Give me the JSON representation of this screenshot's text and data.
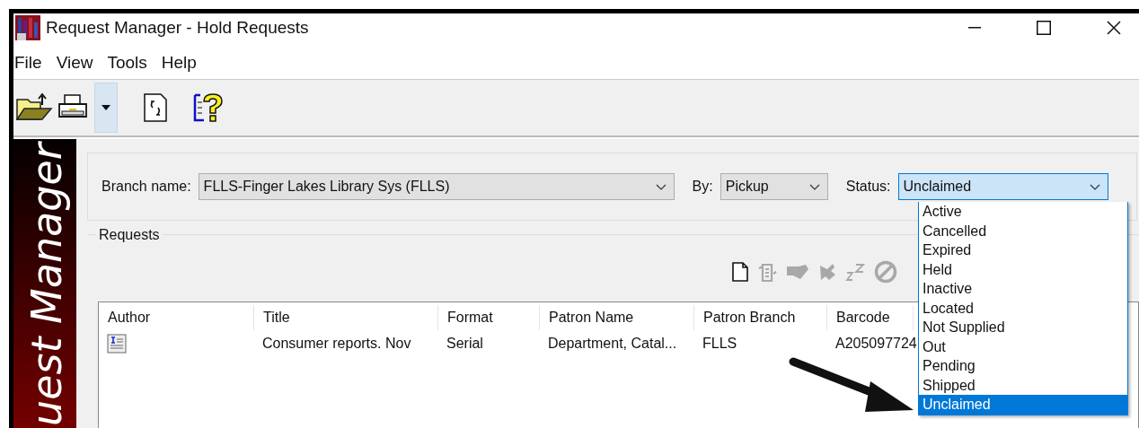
{
  "window": {
    "title": "Request Manager - Hold Requests"
  },
  "menu": [
    "File",
    "View",
    "Tools",
    "Help"
  ],
  "banner": {
    "text": "uest Manager"
  },
  "filters": [
    {
      "label": "Branch name:",
      "value": "FLLS-Finger Lakes Library Sys (FLLS)",
      "focused": false
    },
    {
      "label": "By:",
      "value": "Pickup",
      "focused": false
    },
    {
      "label": "Status:",
      "value": "Unclaimed",
      "focused": true
    }
  ],
  "status_options": [
    {
      "label": "Active",
      "selected": false
    },
    {
      "label": "Cancelled",
      "selected": false
    },
    {
      "label": "Expired",
      "selected": false
    },
    {
      "label": "Held",
      "selected": false
    },
    {
      "label": "Inactive",
      "selected": false
    },
    {
      "label": "Located",
      "selected": false
    },
    {
      "label": "Not Supplied",
      "selected": false
    },
    {
      "label": "Out",
      "selected": false
    },
    {
      "label": "Pending",
      "selected": false
    },
    {
      "label": "Shipped",
      "selected": false
    },
    {
      "label": "Unclaimed",
      "selected": true
    }
  ],
  "requests": {
    "title": "Requests",
    "actions": [
      {
        "kind": "new",
        "disabled": false
      },
      {
        "kind": "update",
        "disabled": true
      },
      {
        "kind": "ship",
        "disabled": true
      },
      {
        "kind": "cancel",
        "disabled": true
      },
      {
        "kind": "sleep",
        "disabled": true
      },
      {
        "kind": "deny",
        "disabled": true
      }
    ],
    "columns": [
      "Author",
      "Title",
      "Format",
      "Patron Name",
      "Patron Branch",
      "Barcode"
    ],
    "rows": [
      {
        "title": "Consumer reports. Nov",
        "format": "Serial",
        "patron_name": "Department, Catal...",
        "patron_branch": "FLLS",
        "barcode": "A205097724"
      }
    ]
  }
}
